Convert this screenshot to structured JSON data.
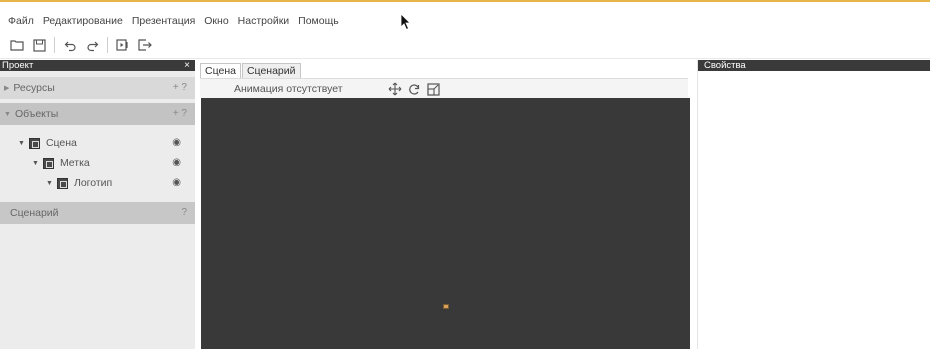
{
  "menu": [
    "Файл",
    "Редактирование",
    "Презентация",
    "Окно",
    "Настройки",
    "Помощь"
  ],
  "toolbar": {
    "icons": [
      "folder-open-icon",
      "save-icon",
      "undo-icon",
      "redo-icon",
      "preview-icon",
      "export-icon"
    ]
  },
  "left_panel": {
    "title": "Проект",
    "close": "×",
    "resources": {
      "label": "Ресурсы",
      "actions": "+ ?"
    },
    "objects": {
      "label": "Объекты",
      "actions": "+ ?"
    },
    "tree": [
      {
        "label": "Сцена"
      },
      {
        "label": "Метка"
      },
      {
        "label": "Логотип"
      }
    ],
    "scenario": {
      "label": "Сценарий",
      "actions": "?"
    }
  },
  "center": {
    "tabs": [
      "Сцена",
      "Сценарий"
    ],
    "animation_label": "Анимация отсутствует"
  },
  "right_panel": {
    "title": "Свойства"
  },
  "colors": {
    "accent_line": "#e8b54a",
    "viewport": "#393939",
    "panel_title": "#3a3a3a"
  }
}
